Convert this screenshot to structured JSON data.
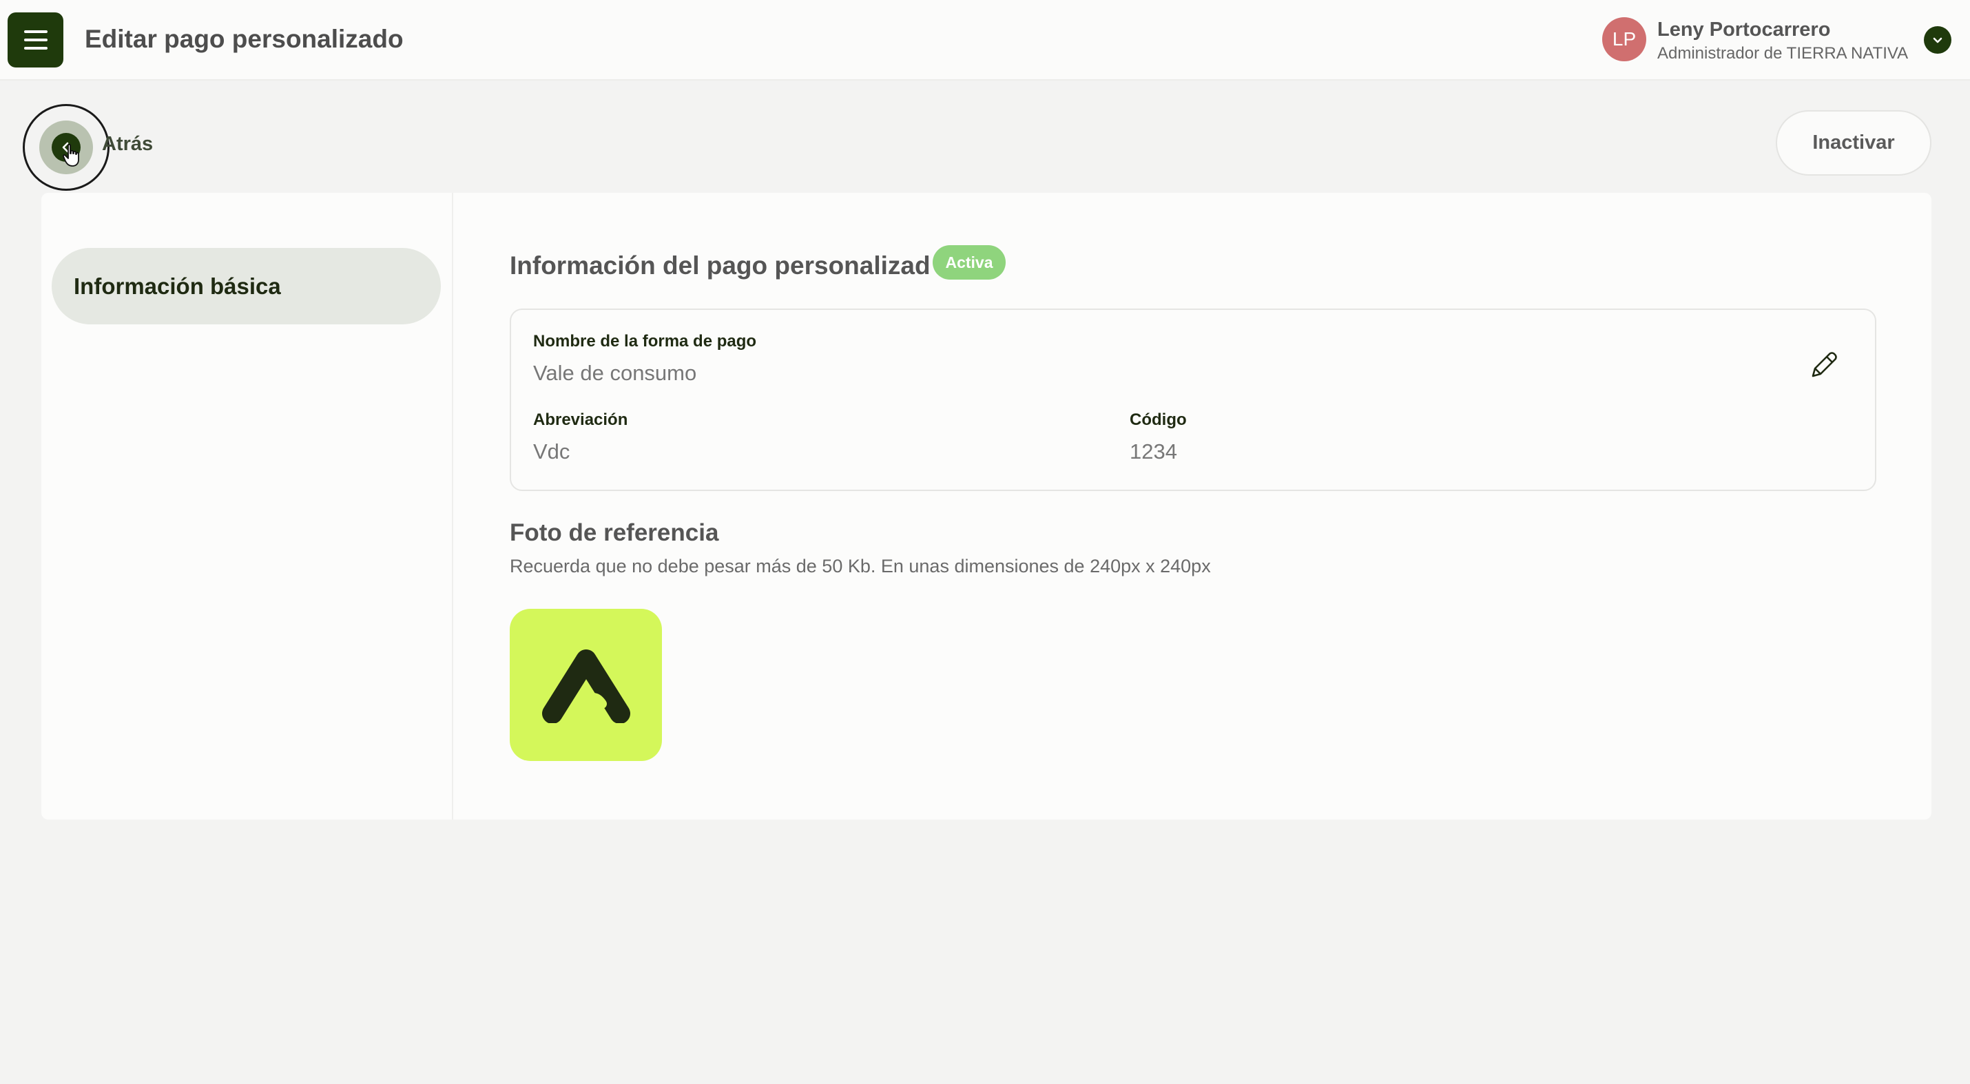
{
  "header": {
    "menu_icon": "hamburger-icon",
    "title": "Editar pago personalizado",
    "user": {
      "initials": "LP",
      "name": "Leny Portocarrero",
      "role": "Administrador de TIERRA NATIVA",
      "menu_icon": "chevron-down-icon"
    }
  },
  "toolbar": {
    "back_label": "Atrás",
    "back_icon": "chevron-left-icon",
    "inactivate_label": "Inactivar"
  },
  "sidebar": {
    "items": [
      {
        "label": "Información básica",
        "active": true
      }
    ]
  },
  "main": {
    "section_title": "Información del pago personalizad",
    "status": "Activa",
    "fields": {
      "name_label": "Nombre de la forma de pago",
      "name_value": "Vale de consumo",
      "abbr_label": "Abreviación",
      "abbr_value": "Vdc",
      "code_label": "Código",
      "code_value": "1234"
    },
    "edit_icon": "pencil-icon",
    "photo": {
      "title": "Foto de referencia",
      "hint": "Recuerda que no debe pesar más de 50 Kb. En unas dimensiones de 240px x 240px",
      "image_icon": "brand-logo-icon"
    }
  },
  "colors": {
    "brand_dark": "#1f3a0c",
    "badge_active": "#8fd47d",
    "logo_bg": "#d4f75a",
    "avatar_bg": "#d06f6f"
  }
}
